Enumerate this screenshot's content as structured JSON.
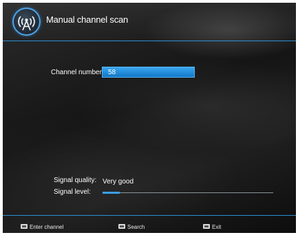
{
  "header": {
    "title": "Manual channel scan",
    "logo_icon": "antenna-broadcast-icon"
  },
  "form": {
    "channel_label": "Channel number:",
    "channel_value": "58",
    "signal_quality_label": "Signal quality:",
    "signal_quality_value": "Very good",
    "signal_level_label": "Signal level:",
    "signal_level_fraction": 0.1
  },
  "footer": {
    "items": [
      {
        "key_icon": "keypad-key-icon",
        "label": "Enter channel"
      },
      {
        "key_icon": "ok-key-icon",
        "label": "Search"
      },
      {
        "key_icon": "menu-key-icon",
        "label": "Exit"
      }
    ]
  },
  "colors": {
    "accent": "#2c8fd6",
    "field_fill": "#1a86d8",
    "background": "#1a1a1a"
  }
}
